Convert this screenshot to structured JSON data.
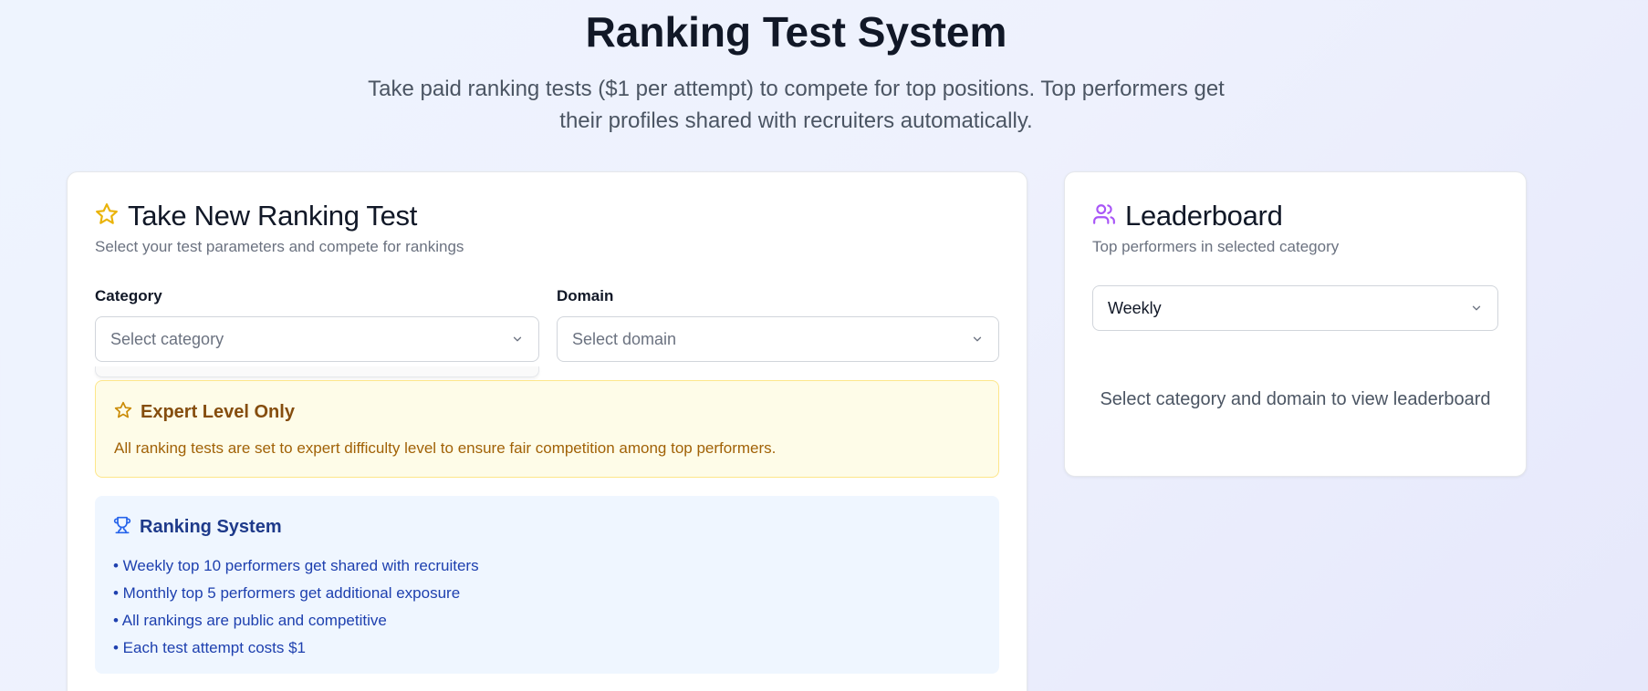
{
  "header": {
    "title": "Ranking Test System",
    "subtitle": "Take paid ranking tests ($1 per attempt) to compete for top positions. Top performers get their profiles shared with recruiters automatically."
  },
  "test_card": {
    "title": "Take New Ranking Test",
    "description": "Select your test parameters and compete for rankings",
    "category": {
      "label": "Category",
      "placeholder": "Select category"
    },
    "domain": {
      "label": "Domain",
      "placeholder": "Select domain"
    },
    "notice": {
      "title": "Expert Level Only",
      "text": "All ranking tests are set to expert difficulty level to ensure fair competition among top performers."
    },
    "ranking_system": {
      "title": "Ranking System",
      "items": [
        "• Weekly top 10 performers get shared with recruiters",
        "• Monthly top 5 performers get additional exposure",
        "• All rankings are public and competitive",
        "• Each test attempt costs $1"
      ]
    }
  },
  "leaderboard": {
    "title": "Leaderboard",
    "description": "Top performers in selected category",
    "period_value": "Weekly",
    "empty_message": "Select category and domain to view leaderboard"
  },
  "colors": {
    "star_icon": "#eab308",
    "users_icon": "#a855f7",
    "notice_star": "#ca8a04",
    "trophy_icon": "#2563eb"
  },
  "icons": [
    "star-icon",
    "users-icon",
    "chevron-down-icon",
    "trophy-icon"
  ]
}
